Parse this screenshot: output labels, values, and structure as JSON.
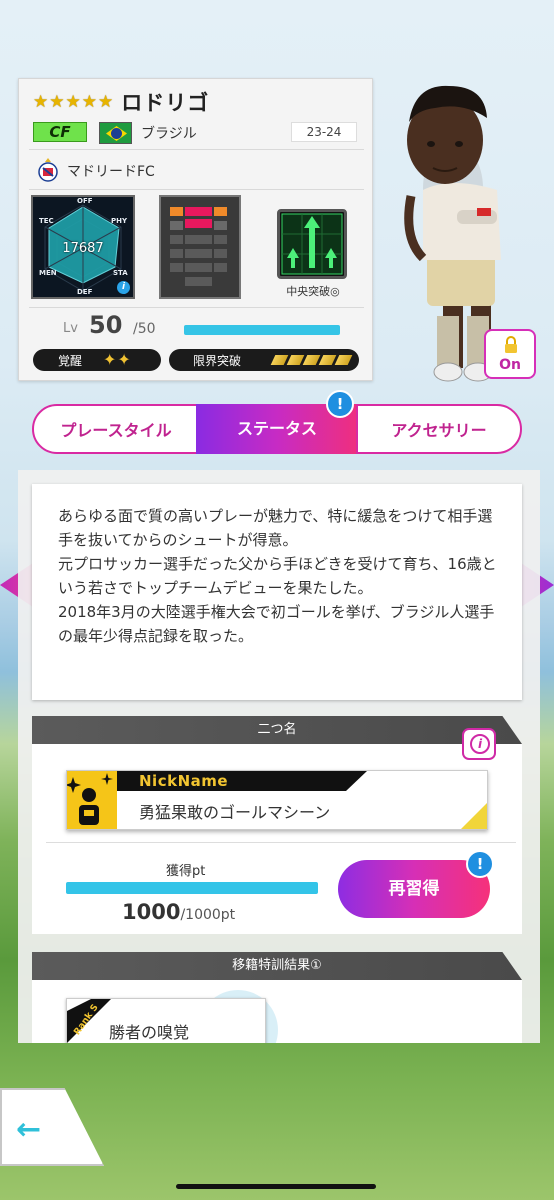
{
  "player": {
    "name": "ロドリゴ",
    "stars": 5,
    "position": "CF",
    "country": "ブラジル",
    "season": "23-24",
    "club": "マドリードFC",
    "radar": {
      "labels": {
        "top": "OFF",
        "upper_left": "TEC",
        "upper_right": "PHY",
        "lower_left": "MEN",
        "lower_right": "STA",
        "bottom": "DEF"
      },
      "total": "17687"
    },
    "playstyle_label": "中央突破◎",
    "level": {
      "label": "Lv",
      "value": "50",
      "max": "/50",
      "fill": 1.0
    },
    "awaken_label": "覚醒",
    "awaken_level": 2,
    "limit_label": "限界突破",
    "limit_level": 5
  },
  "lock_button": {
    "label": "On",
    "icon": "lock-icon"
  },
  "tabs": {
    "playstyle": "プレースタイル",
    "status": "ステータス",
    "accessory": "アクセサリー",
    "badge": "!"
  },
  "description": "あらゆる面で質の高いプレーが魅力で、特に緩急をつけて相手選手を抜いてからのシュートが得意。\n元プロサッカー選手だった父から手ほどきを受けて育ち、16歳という若さでトップチームデビューを果たした。\n2018年3月の大陸選手権大会で初ゴールを挙げ、ブラジル人選手の最年少得点記録を取った。",
  "nickname_section": {
    "header": "二つ名",
    "card_label": "NickName",
    "title": "勇猛果敢のゴールマシーン",
    "points_label": "獲得pt",
    "points_value": "1000",
    "points_unit": "/1000pt",
    "points_fill": 1.0,
    "relearn_button": "再習得",
    "badge": "!"
  },
  "transfer_section": {
    "header": "移籍特訓結果①",
    "rank": "Rank S",
    "skill_name": "勝者の嗅覚"
  },
  "colors": {
    "accent": "#d62fb6",
    "position_badge": "#6fe24b",
    "bar": "#33c4e8",
    "badge": "#1f8fe0"
  }
}
